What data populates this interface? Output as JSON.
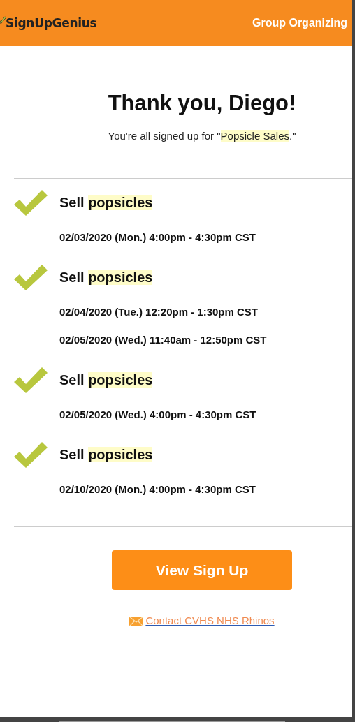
{
  "header": {
    "logo": "SignUpGenius",
    "tagline": "Group Organizing"
  },
  "heading": "Thank you, Diego!",
  "subtitle": {
    "before": "You're all signed up for \"",
    "highlight": "Popsicle Sales",
    "after": ".\""
  },
  "slots": [
    {
      "checked": true,
      "title": "Sell",
      "highlight": "popsicles",
      "times": [
        "02/03/2020 (Mon.) 4:00pm - 4:30pm CST"
      ]
    },
    {
      "checked": true,
      "title": "Sell",
      "highlight": "popsicles",
      "times": [
        "02/04/2020 (Tue.) 12:20pm - 1:30pm CST",
        "02/05/2020 (Wed.) 11:40am - 12:50pm CST"
      ]
    },
    {
      "checked": true,
      "title": "Sell",
      "highlight": "popsicles",
      "times": [
        "02/05/2020 (Wed.) 4:00pm - 4:30pm CST"
      ]
    },
    {
      "checked": true,
      "title": "Sell",
      "highlight": "popsicles",
      "times": [
        "02/10/2020 (Mon.) 4:00pm - 4:30pm CST"
      ]
    }
  ],
  "button": "View Sign Up",
  "contact_link": "Contact CVHS NHS Rhinos"
}
